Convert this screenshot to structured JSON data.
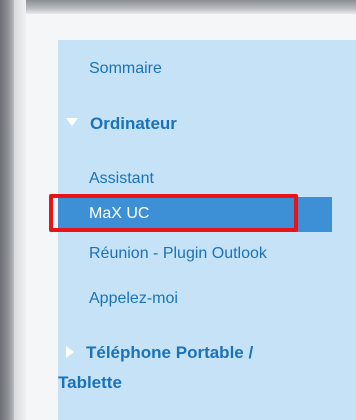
{
  "menu": {
    "summary": "Sommaire",
    "section_computer": "Ordinateur",
    "items": [
      "Assistant",
      "MaX UC",
      "Réunion - Plugin Outlook",
      "Appelez-moi"
    ],
    "selected_index": 1,
    "section_mobile_line1": "Téléphone Portable /",
    "section_mobile_line2": "Tablette"
  },
  "colors": {
    "panel_bg": "#c6e2f7",
    "link": "#1a73b8",
    "selected_bg": "#3d8fd6",
    "highlight_border": "#e8141a"
  },
  "icons": {
    "expanded": "triangle-down-icon",
    "collapsed": "triangle-right-icon"
  }
}
